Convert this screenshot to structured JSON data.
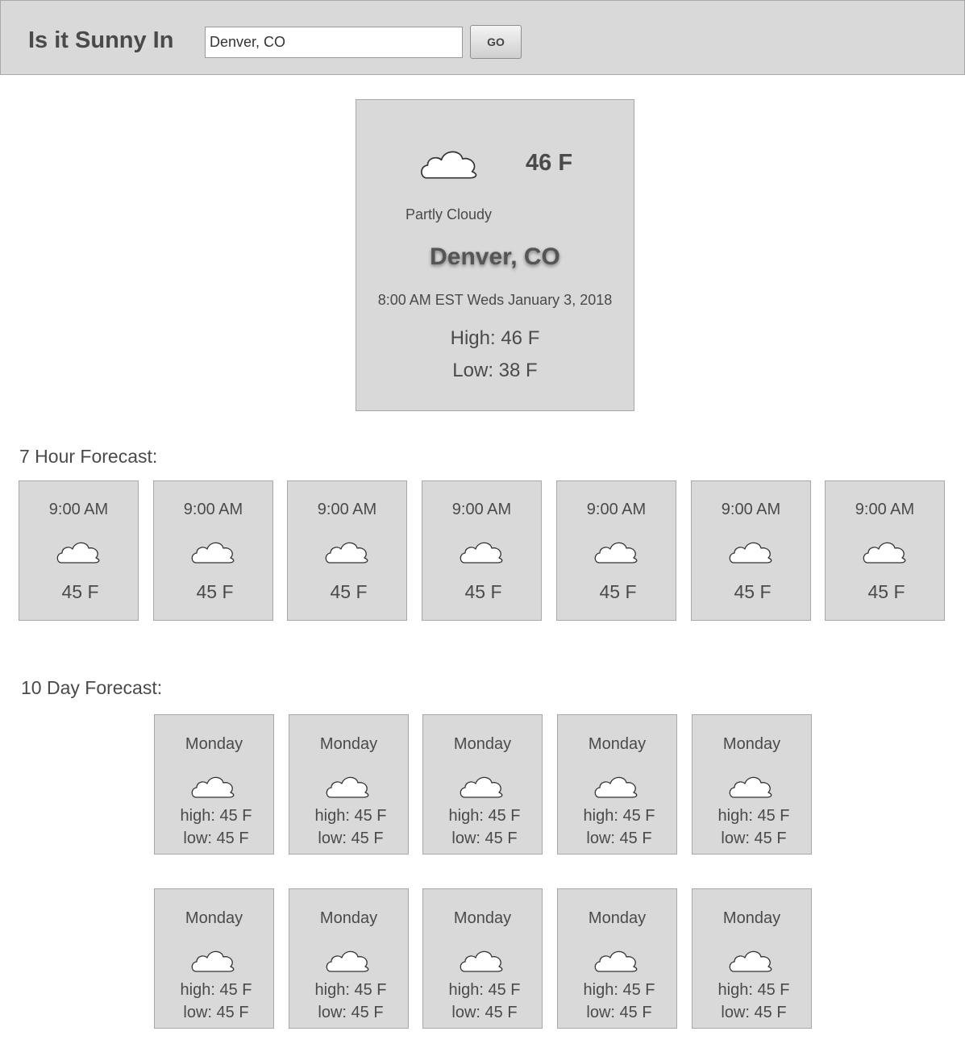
{
  "header": {
    "title": "Is it Sunny In",
    "search_value": "Denver, CO",
    "go_label": "GO"
  },
  "current": {
    "icon": "cloud-icon",
    "temperature": "46 F",
    "condition": "Partly Cloudy",
    "city": "Denver, CO",
    "datetime": "8:00 AM EST Weds January 3, 2018",
    "high": "High: 46 F",
    "low": "Low: 38 F"
  },
  "hourly": {
    "label": "7 Hour Forecast:",
    "items": [
      {
        "time": "9:00 AM",
        "icon": "cloud-icon",
        "temp": "45 F"
      },
      {
        "time": "9:00 AM",
        "icon": "cloud-icon",
        "temp": "45 F"
      },
      {
        "time": "9:00 AM",
        "icon": "cloud-icon",
        "temp": "45 F"
      },
      {
        "time": "9:00 AM",
        "icon": "cloud-icon",
        "temp": "45 F"
      },
      {
        "time": "9:00 AM",
        "icon": "cloud-icon",
        "temp": "45 F"
      },
      {
        "time": "9:00 AM",
        "icon": "cloud-icon",
        "temp": "45 F"
      },
      {
        "time": "9:00 AM",
        "icon": "cloud-icon",
        "temp": "45 F"
      }
    ]
  },
  "daily": {
    "label": "10 Day Forecast:",
    "items": [
      {
        "day": "Monday",
        "icon": "cloud-icon",
        "high": "high: 45 F",
        "low": "low: 45 F"
      },
      {
        "day": "Monday",
        "icon": "cloud-icon",
        "high": "high: 45 F",
        "low": "low: 45 F"
      },
      {
        "day": "Monday",
        "icon": "cloud-icon",
        "high": "high: 45 F",
        "low": "low: 45 F"
      },
      {
        "day": "Monday",
        "icon": "cloud-icon",
        "high": "high: 45 F",
        "low": "low: 45 F"
      },
      {
        "day": "Monday",
        "icon": "cloud-icon",
        "high": "high: 45 F",
        "low": "low: 45 F"
      },
      {
        "day": "Monday",
        "icon": "cloud-icon",
        "high": "high: 45 F",
        "low": "low: 45 F"
      },
      {
        "day": "Monday",
        "icon": "cloud-icon",
        "high": "high: 45 F",
        "low": "low: 45 F"
      },
      {
        "day": "Monday",
        "icon": "cloud-icon",
        "high": "high: 45 F",
        "low": "low: 45 F"
      },
      {
        "day": "Monday",
        "icon": "cloud-icon",
        "high": "high: 45 F",
        "low": "low: 45 F"
      },
      {
        "day": "Monday",
        "icon": "cloud-icon",
        "high": "high: 45 F",
        "low": "low: 45 F"
      }
    ]
  }
}
